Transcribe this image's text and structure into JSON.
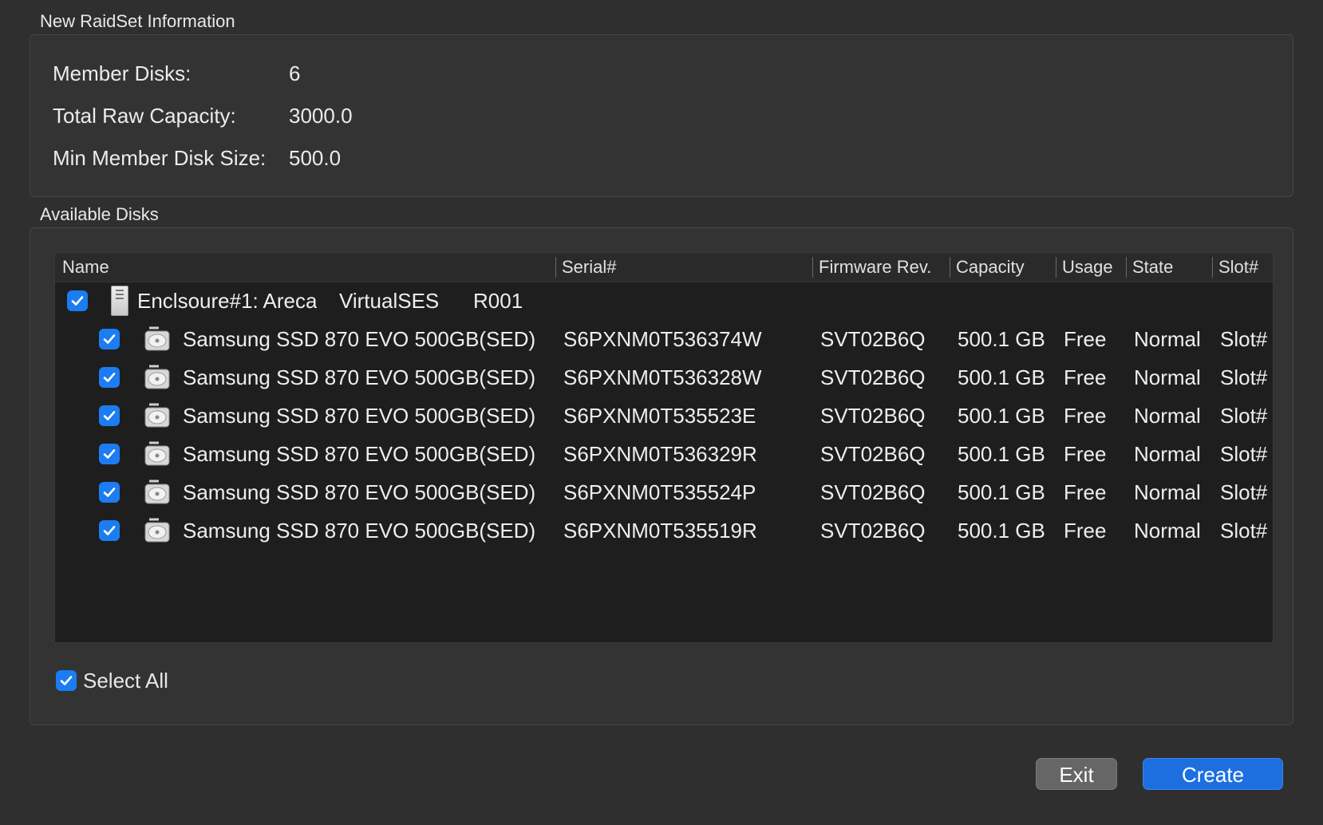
{
  "info_section": {
    "title": "New RaidSet Information",
    "rows": [
      {
        "label": "Member Disks:",
        "value": "6"
      },
      {
        "label": "Total Raw Capacity:",
        "value": "3000.0"
      },
      {
        "label": "Min Member Disk Size:",
        "value": "500.0"
      }
    ]
  },
  "disks_section": {
    "title": "Available Disks",
    "columns": [
      "Name",
      "Serial#",
      "Firmware Rev.",
      "Capacity",
      "Usage",
      "State",
      "Slot#"
    ],
    "enclosure": {
      "name": "Enclsoure#1: Areca",
      "model": "VirtualSES",
      "rev": "R001",
      "checked": true,
      "icon": "enclosure-icon"
    },
    "disks": [
      {
        "name": "Samsung SSD 870 EVO 500GB(SED)",
        "serial": "S6PXNM0T536374W",
        "firmware": "SVT02B6Q",
        "capacity": "500.1 GB",
        "usage": "Free",
        "state": "Normal",
        "slot": "Slot#",
        "checked": true
      },
      {
        "name": "Samsung SSD 870 EVO 500GB(SED)",
        "serial": "S6PXNM0T536328W",
        "firmware": "SVT02B6Q",
        "capacity": "500.1 GB",
        "usage": "Free",
        "state": "Normal",
        "slot": "Slot#",
        "checked": true
      },
      {
        "name": "Samsung SSD 870 EVO 500GB(SED)",
        "serial": "S6PXNM0T535523E",
        "firmware": "SVT02B6Q",
        "capacity": "500.1 GB",
        "usage": "Free",
        "state": "Normal",
        "slot": "Slot#",
        "checked": true
      },
      {
        "name": "Samsung SSD 870 EVO 500GB(SED)",
        "serial": "S6PXNM0T536329R",
        "firmware": "SVT02B6Q",
        "capacity": "500.1 GB",
        "usage": "Free",
        "state": "Normal",
        "slot": "Slot#",
        "checked": true
      },
      {
        "name": "Samsung SSD 870 EVO 500GB(SED)",
        "serial": "S6PXNM0T535524P",
        "firmware": "SVT02B6Q",
        "capacity": "500.1 GB",
        "usage": "Free",
        "state": "Normal",
        "slot": "Slot#",
        "checked": true
      },
      {
        "name": "Samsung SSD 870 EVO 500GB(SED)",
        "serial": "S6PXNM0T535519R",
        "firmware": "SVT02B6Q",
        "capacity": "500.1 GB",
        "usage": "Free",
        "state": "Normal",
        "slot": "Slot#",
        "checked": true
      }
    ],
    "select_all": {
      "label": "Select All",
      "checked": true
    }
  },
  "buttons": {
    "exit_label": "Exit",
    "create_label": "Create"
  },
  "colors": {
    "background": "#2f2f2f",
    "table_background": "#1e1e1e",
    "accent": "#1c7cf2",
    "create_button": "#1d6fe0"
  }
}
